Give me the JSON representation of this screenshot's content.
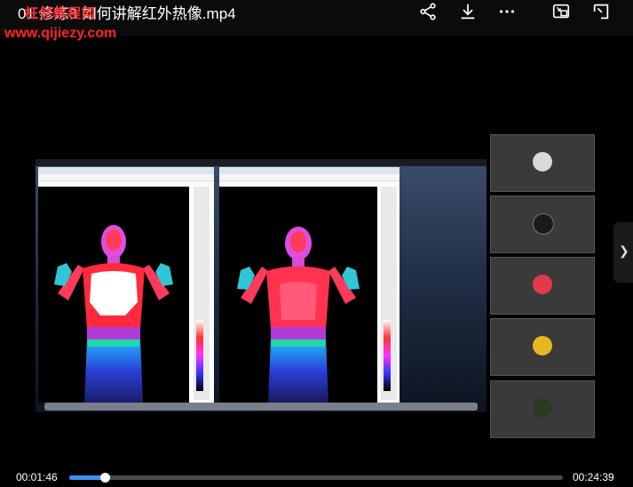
{
  "video": {
    "title": "01.修炼3 如何讲解红外热像.mp4",
    "current_time": "00:01:46",
    "duration": "00:24:39",
    "progress": 0.0717
  },
  "watermark": {
    "site_name": "枉然教程网",
    "site_url": "www.qijiezy.com"
  },
  "toolbar_icons": [
    "share-icon",
    "download-icon",
    "more-icon",
    "picture-in-picture-icon",
    "fullscreen-icon"
  ],
  "participants_count": 5,
  "colors": {
    "progress": "#3d8ff0",
    "watermark": "#ff2424"
  }
}
